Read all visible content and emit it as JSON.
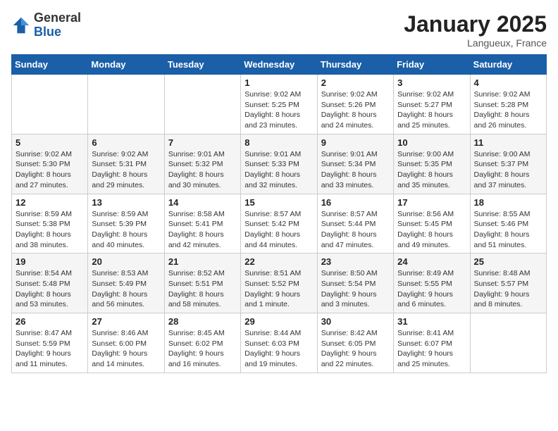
{
  "header": {
    "logo_general": "General",
    "logo_blue": "Blue",
    "month_title": "January 2025",
    "location": "Langueux, France"
  },
  "days_of_week": [
    "Sunday",
    "Monday",
    "Tuesday",
    "Wednesday",
    "Thursday",
    "Friday",
    "Saturday"
  ],
  "weeks": [
    [
      {
        "day": "",
        "info": ""
      },
      {
        "day": "",
        "info": ""
      },
      {
        "day": "",
        "info": ""
      },
      {
        "day": "1",
        "info": "Sunrise: 9:02 AM\nSunset: 5:25 PM\nDaylight: 8 hours\nand 23 minutes."
      },
      {
        "day": "2",
        "info": "Sunrise: 9:02 AM\nSunset: 5:26 PM\nDaylight: 8 hours\nand 24 minutes."
      },
      {
        "day": "3",
        "info": "Sunrise: 9:02 AM\nSunset: 5:27 PM\nDaylight: 8 hours\nand 25 minutes."
      },
      {
        "day": "4",
        "info": "Sunrise: 9:02 AM\nSunset: 5:28 PM\nDaylight: 8 hours\nand 26 minutes."
      }
    ],
    [
      {
        "day": "5",
        "info": "Sunrise: 9:02 AM\nSunset: 5:30 PM\nDaylight: 8 hours\nand 27 minutes."
      },
      {
        "day": "6",
        "info": "Sunrise: 9:02 AM\nSunset: 5:31 PM\nDaylight: 8 hours\nand 29 minutes."
      },
      {
        "day": "7",
        "info": "Sunrise: 9:01 AM\nSunset: 5:32 PM\nDaylight: 8 hours\nand 30 minutes."
      },
      {
        "day": "8",
        "info": "Sunrise: 9:01 AM\nSunset: 5:33 PM\nDaylight: 8 hours\nand 32 minutes."
      },
      {
        "day": "9",
        "info": "Sunrise: 9:01 AM\nSunset: 5:34 PM\nDaylight: 8 hours\nand 33 minutes."
      },
      {
        "day": "10",
        "info": "Sunrise: 9:00 AM\nSunset: 5:35 PM\nDaylight: 8 hours\nand 35 minutes."
      },
      {
        "day": "11",
        "info": "Sunrise: 9:00 AM\nSunset: 5:37 PM\nDaylight: 8 hours\nand 37 minutes."
      }
    ],
    [
      {
        "day": "12",
        "info": "Sunrise: 8:59 AM\nSunset: 5:38 PM\nDaylight: 8 hours\nand 38 minutes."
      },
      {
        "day": "13",
        "info": "Sunrise: 8:59 AM\nSunset: 5:39 PM\nDaylight: 8 hours\nand 40 minutes."
      },
      {
        "day": "14",
        "info": "Sunrise: 8:58 AM\nSunset: 5:41 PM\nDaylight: 8 hours\nand 42 minutes."
      },
      {
        "day": "15",
        "info": "Sunrise: 8:57 AM\nSunset: 5:42 PM\nDaylight: 8 hours\nand 44 minutes."
      },
      {
        "day": "16",
        "info": "Sunrise: 8:57 AM\nSunset: 5:44 PM\nDaylight: 8 hours\nand 47 minutes."
      },
      {
        "day": "17",
        "info": "Sunrise: 8:56 AM\nSunset: 5:45 PM\nDaylight: 8 hours\nand 49 minutes."
      },
      {
        "day": "18",
        "info": "Sunrise: 8:55 AM\nSunset: 5:46 PM\nDaylight: 8 hours\nand 51 minutes."
      }
    ],
    [
      {
        "day": "19",
        "info": "Sunrise: 8:54 AM\nSunset: 5:48 PM\nDaylight: 8 hours\nand 53 minutes."
      },
      {
        "day": "20",
        "info": "Sunrise: 8:53 AM\nSunset: 5:49 PM\nDaylight: 8 hours\nand 56 minutes."
      },
      {
        "day": "21",
        "info": "Sunrise: 8:52 AM\nSunset: 5:51 PM\nDaylight: 8 hours\nand 58 minutes."
      },
      {
        "day": "22",
        "info": "Sunrise: 8:51 AM\nSunset: 5:52 PM\nDaylight: 9 hours\nand 1 minute."
      },
      {
        "day": "23",
        "info": "Sunrise: 8:50 AM\nSunset: 5:54 PM\nDaylight: 9 hours\nand 3 minutes."
      },
      {
        "day": "24",
        "info": "Sunrise: 8:49 AM\nSunset: 5:55 PM\nDaylight: 9 hours\nand 6 minutes."
      },
      {
        "day": "25",
        "info": "Sunrise: 8:48 AM\nSunset: 5:57 PM\nDaylight: 9 hours\nand 8 minutes."
      }
    ],
    [
      {
        "day": "26",
        "info": "Sunrise: 8:47 AM\nSunset: 5:59 PM\nDaylight: 9 hours\nand 11 minutes."
      },
      {
        "day": "27",
        "info": "Sunrise: 8:46 AM\nSunset: 6:00 PM\nDaylight: 9 hours\nand 14 minutes."
      },
      {
        "day": "28",
        "info": "Sunrise: 8:45 AM\nSunset: 6:02 PM\nDaylight: 9 hours\nand 16 minutes."
      },
      {
        "day": "29",
        "info": "Sunrise: 8:44 AM\nSunset: 6:03 PM\nDaylight: 9 hours\nand 19 minutes."
      },
      {
        "day": "30",
        "info": "Sunrise: 8:42 AM\nSunset: 6:05 PM\nDaylight: 9 hours\nand 22 minutes."
      },
      {
        "day": "31",
        "info": "Sunrise: 8:41 AM\nSunset: 6:07 PM\nDaylight: 9 hours\nand 25 minutes."
      },
      {
        "day": "",
        "info": ""
      }
    ]
  ]
}
